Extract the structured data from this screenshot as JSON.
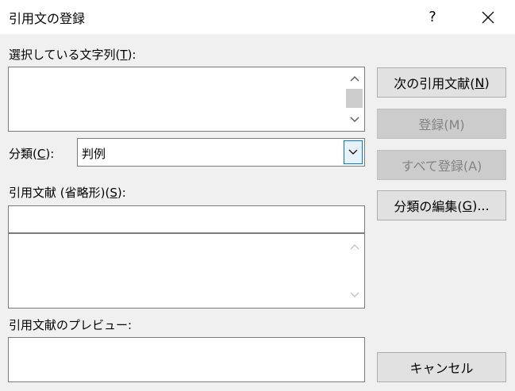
{
  "window": {
    "title": "引用文の登録",
    "help_label": "?"
  },
  "selected_text": {
    "label_pre": "選択している文字列(",
    "label_key": "T",
    "label_post": "):",
    "value": ""
  },
  "category": {
    "label_pre": "分類(",
    "label_key": "C",
    "label_post": "):",
    "value": "判例"
  },
  "short_citation": {
    "label_pre": "引用文献 (省略形)(",
    "label_key": "S",
    "label_post": "):",
    "value": ""
  },
  "preview": {
    "label": "引用文献のプレビュー:"
  },
  "buttons": {
    "next_pre": "次の引用文献(",
    "next_key": "N",
    "next_post": ")",
    "register": "登録(M)",
    "register_all": "すべて登録(A)",
    "edit_pre": "分類の編集(",
    "edit_key": "G",
    "edit_post": ")...",
    "cancel": "キャンセル"
  },
  "icons": {
    "close": "close-icon",
    "scroll_up": "chevron-up-icon",
    "scroll_down": "chevron-down-icon",
    "dropdown": "chevron-down-icon"
  }
}
